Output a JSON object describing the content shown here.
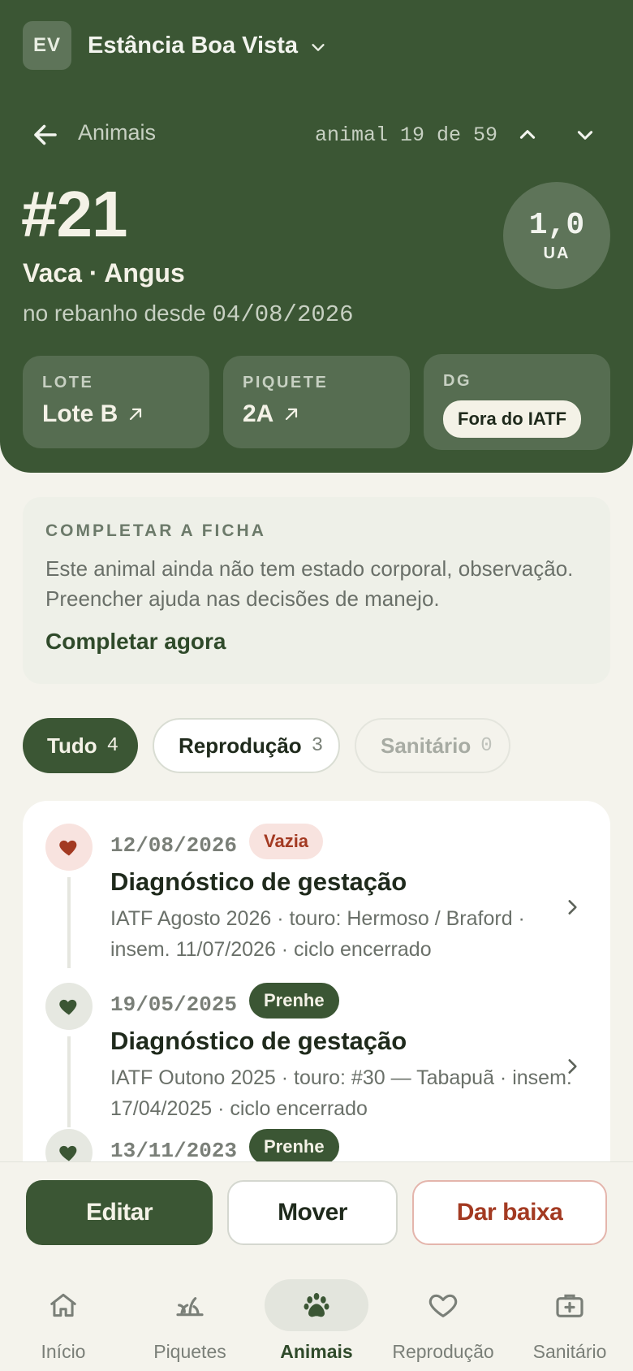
{
  "farm": {
    "initials": "EV",
    "name": "Estância Boa Vista"
  },
  "nav": {
    "back_label": "Animais",
    "position": "animal 19 de 59"
  },
  "animal": {
    "id": "#21",
    "type": "Vaca · Angus",
    "since_prefix": "no rebanho desde",
    "since_date": "04/08/2026",
    "ua_value": "1,0",
    "ua_unit": "UA"
  },
  "cards": {
    "lote": {
      "label": "LOTE",
      "value": "Lote B"
    },
    "piquete": {
      "label": "PIQUETE",
      "value": "2A"
    },
    "dg": {
      "label": "DG",
      "value": "Fora do IATF"
    }
  },
  "complete": {
    "title": "COMPLETAR A FICHA",
    "description": "Este animal ainda não tem estado corporal, observação. Preencher ajuda nas decisões de manejo.",
    "link": "Completar agora"
  },
  "filters": [
    {
      "label": "Tudo",
      "count": "4"
    },
    {
      "label": "Reprodução",
      "count": "3"
    },
    {
      "label": "Sanitário",
      "count": "0"
    }
  ],
  "events": [
    {
      "date": "12/08/2026",
      "badge": "Vazia",
      "title": "Diagnóstico de gestação",
      "description": "IATF Agosto 2026 · touro: Hermoso / Braford · insem. 11/07/2026 · ciclo encerrado",
      "status_color": "#a33a22"
    },
    {
      "date": "19/05/2025",
      "badge": "Prenhe",
      "title": "Diagnóstico de gestação",
      "description": "IATF Outono 2025 · touro: #30 — Tabapuã · insem. 17/04/2025 · ciclo encerrado",
      "status_color": "#3b5634"
    },
    {
      "date": "13/11/2023",
      "badge": "Prenhe",
      "title": "",
      "description": "",
      "status_color": "#3b5634"
    }
  ],
  "actions": {
    "edit": "Editar",
    "move": "Mover",
    "drop": "Dar baixa"
  },
  "tabs": [
    {
      "label": "Início",
      "icon": "home-icon"
    },
    {
      "label": "Piquetes",
      "icon": "grass-icon"
    },
    {
      "label": "Animais",
      "icon": "paw-icon"
    },
    {
      "label": "Reprodução",
      "icon": "heart-icon"
    },
    {
      "label": "Sanitário",
      "icon": "medical-kit-icon"
    }
  ],
  "colors": {
    "primary": "#3b5634",
    "background": "#f4f3ec",
    "danger": "#a33a22"
  }
}
